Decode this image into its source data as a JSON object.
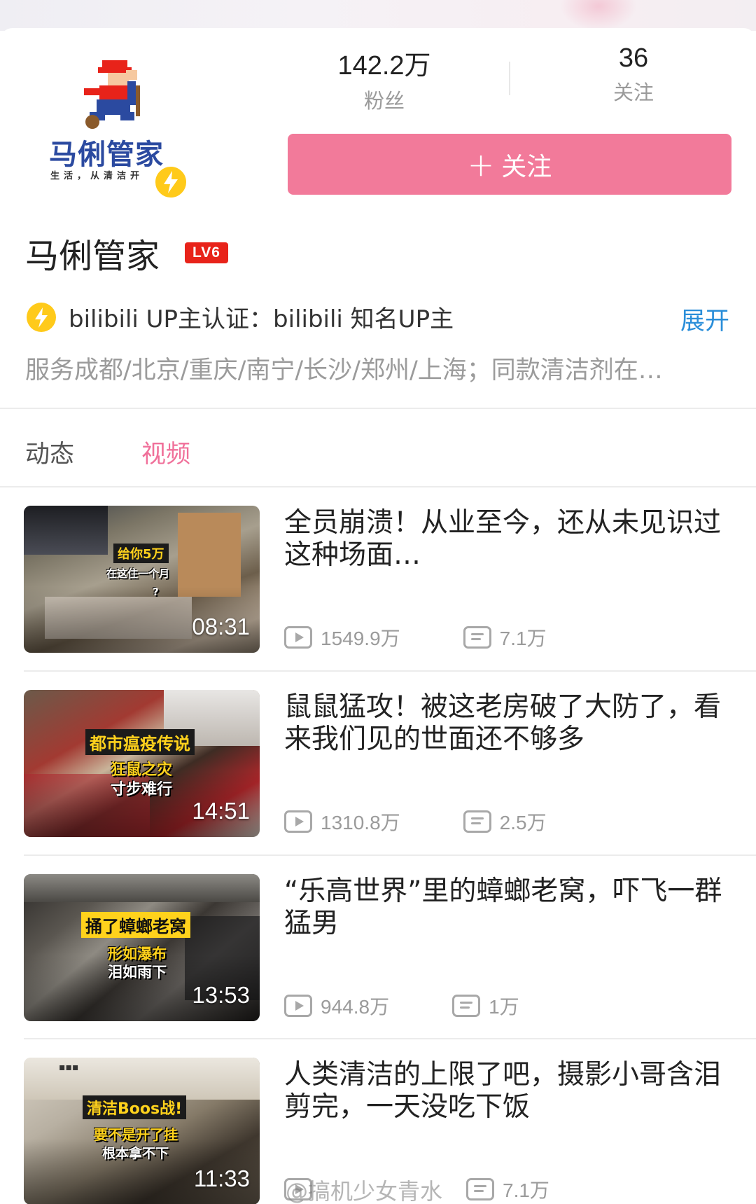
{
  "profile": {
    "logo_text": "马俐管家",
    "logo_tagline": "生活，从清洁开",
    "fans_count": "142.2万",
    "fans_label": "粉丝",
    "following_count": "36",
    "following_label": "关注",
    "follow_button_label": "关注",
    "name": "马俐管家",
    "level": "LV6",
    "verification": "bilibili UP主认证：bilibili 知名UP主",
    "expand_label": "展开",
    "description": "服务成都/北京/重庆/南宁/长沙/郑州/上海；同款清洁剂在…"
  },
  "tabs": [
    {
      "label": "动态",
      "active": false
    },
    {
      "label": "视频",
      "active": true
    }
  ],
  "videos": [
    {
      "title": "全员崩溃！从业至今，还从未见识过这种场面…",
      "duration": "08:31",
      "views": "1549.9万",
      "comments": "7.1万",
      "thumb_captions": [
        "给你5万",
        "在这住一个月",
        "?"
      ]
    },
    {
      "title": "鼠鼠猛攻！被这老房破了大防了，看来我们见的世面还不够多",
      "duration": "14:51",
      "views": "1310.8万",
      "comments": "2.5万",
      "thumb_captions": [
        "都市瘟疫传说",
        "狂鼠之灾",
        "寸步难行"
      ]
    },
    {
      "title": "“乐高世界”里的蟑螂老窝，吓飞一群猛男",
      "duration": "13:53",
      "views": "944.8万",
      "comments": "1万",
      "thumb_captions": [
        "捅了蟑螂老窝",
        "形如瀑布",
        "泪如雨下"
      ]
    },
    {
      "title": "人类清洁的上限了吧，摄影小哥含泪剪完，一天没吃下饭",
      "duration": "11:33",
      "views": "",
      "comments": "7.1万",
      "thumb_captions": [
        "清洁Boos战!",
        "要不是开了挂",
        "根本拿不下"
      ]
    }
  ],
  "watermark": "@搞机少女青水",
  "colors": {
    "accent_pink": "#f27a9a",
    "tab_active": "#f0709a",
    "link_blue": "#2a8ed9",
    "level_red": "#e8231a",
    "verify_yellow": "#ffca1a"
  },
  "icons": [
    "mascot-logo",
    "lightning-icon",
    "plus-icon",
    "play-icon",
    "danmaku-icon"
  ]
}
